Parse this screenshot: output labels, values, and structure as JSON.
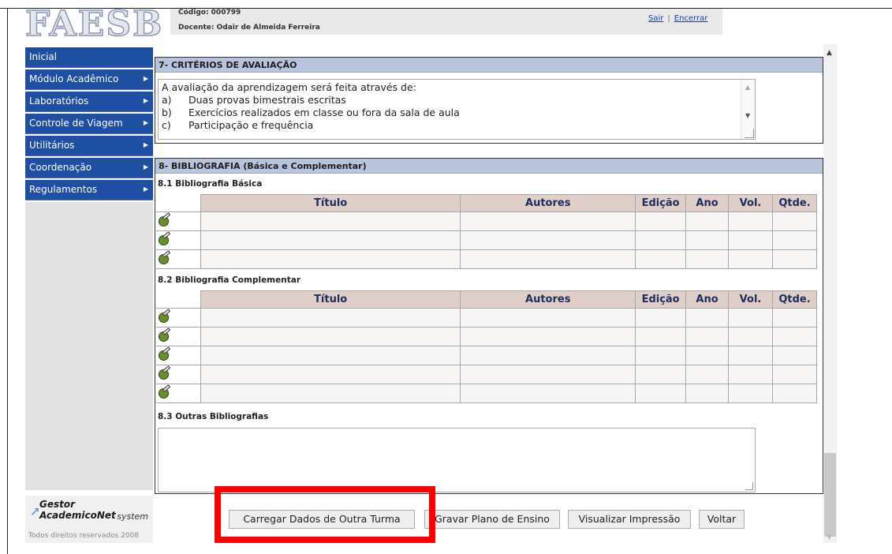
{
  "header": {
    "logo": "FAESB",
    "code_line": "Código:  000799",
    "teacher_line": "Docente: Odair de Almeida Ferreira",
    "logout_label": "Sair",
    "separator": "|",
    "close_label": "Encerrar"
  },
  "sidebar": {
    "items": [
      {
        "label": "Inicial",
        "arrow": ""
      },
      {
        "label": "Módulo Acadêmico",
        "arrow": "▶"
      },
      {
        "label": "Laboratórios",
        "arrow": "▶"
      },
      {
        "label": "Controle de Viagem",
        "arrow": "▶"
      },
      {
        "label": "Utilitários",
        "arrow": "▶"
      },
      {
        "label": "Coordenação",
        "arrow": "▶"
      },
      {
        "label": "Regulamentos",
        "arrow": "▶"
      }
    ],
    "footer_brand": "Gestor AcademicoNet",
    "footer_sub": "system",
    "rights": "Todos direitos reservados 2008"
  },
  "section7": {
    "title": "7- CRITÉRIOS DE AVALIAÇÃO",
    "intro": "A avaliação da aprendizagem será feita através de:",
    "items": [
      {
        "letter": "a)",
        "text": "Duas provas bimestrais escritas"
      },
      {
        "letter": "b)",
        "text": "Exercícios realizados em classe ou fora da sala de aula"
      },
      {
        "letter": "c)",
        "text": "Participação e frequência"
      }
    ]
  },
  "section8": {
    "title": "8- BIBLIOGRAFIA (Básica e Complementar)",
    "basic_title": "8.1 Bibliografia Básica",
    "complementary_title": "8.2 Bibliografia Complementar",
    "other_title": "8.3 Outras Bibliografias",
    "columns": [
      "Título",
      "Autores",
      "Edição",
      "Ano",
      "Vol.",
      "Qtde."
    ]
  },
  "buttons": {
    "load": "Carregar Dados de Outra Turma",
    "save": "Gravar Plano de Ensino",
    "preview": "Visualizar Impressão",
    "back": "Voltar"
  },
  "colors": {
    "menu_bg": "#1e4fa2",
    "section_head": "#b8c4dc",
    "table_head": "#e0cfc8",
    "highlight": "#ff0000"
  }
}
